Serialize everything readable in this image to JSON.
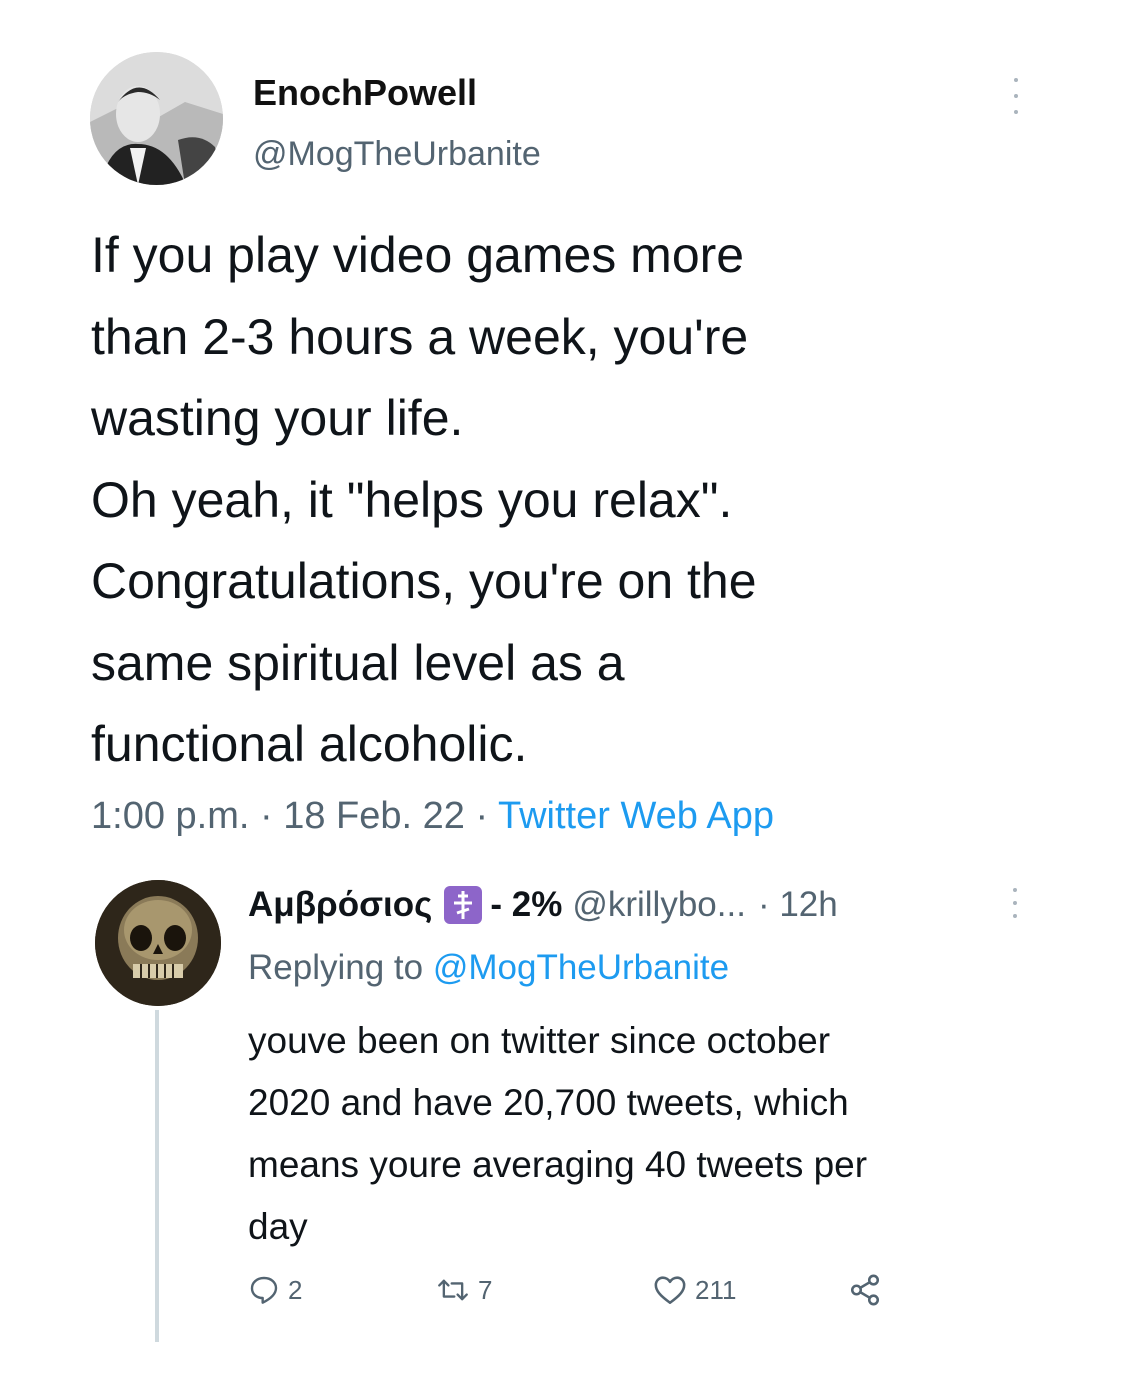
{
  "tweet": {
    "display_name": "EnochPowell",
    "handle": "@MogTheUrbanite",
    "body_lines": [
      "If you play video games more",
      "than 2-3 hours a week, you're",
      "wasting your life.",
      "Oh yeah, it \"helps you relax\".",
      "Congratulations, you're on the",
      "same spiritual level as a",
      "functional alcoholic."
    ],
    "time": "1:00 p.m.",
    "date": "18 Feb. 22",
    "separator": " · ",
    "source": "Twitter Web App",
    "avatar_icon": "person-photo",
    "more_icon": "vertical-ellipsis"
  },
  "reply": {
    "display_name": "Αμβρόσιος",
    "badge_icon": "orthodox-cross",
    "pct": " - 2%",
    "handle": "@krillybo...",
    "time": "· 12h",
    "replying_prefix": "Replying to ",
    "replying_mention": "@MogTheUrbanite",
    "body_lines": [
      "youve been on twitter since october",
      "2020 and have 20,700 tweets, which",
      "means youre averaging 40 tweets per",
      "day"
    ],
    "avatar_icon": "skull-image",
    "actions": {
      "reply_count": "2",
      "retweet_count": "7",
      "like_count": "211"
    }
  },
  "colors": {
    "text": "#0f1419",
    "muted": "#536471",
    "link": "#1d9bf0",
    "badge": "#8d65c9"
  }
}
